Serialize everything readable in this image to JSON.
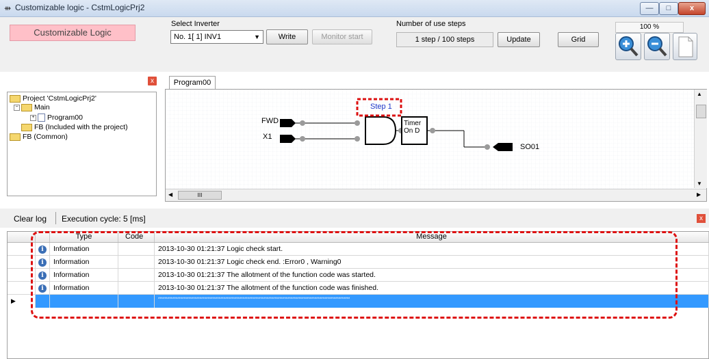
{
  "window": {
    "title": "Customizable logic - CstmLogicPrj2",
    "min": "—",
    "max": "□",
    "close": "x"
  },
  "toolbar": {
    "badge": "Customizable Logic",
    "select_inverter_label": "Select Inverter",
    "inverter_value": "No. 1[ 1] INV1",
    "write_label": "Write",
    "monitor_label": "Monitor start",
    "steps_label": "Number of use steps",
    "steps_value": "1 step / 100 steps",
    "update_label": "Update",
    "grid_label": "Grid",
    "zoom_level": "100 %",
    "icons": [
      "zoom-in-icon",
      "zoom-out-icon",
      "page-icon"
    ]
  },
  "tree": {
    "close": "x",
    "items": [
      "Project 'CstmLogicPrj2'",
      "Main",
      "Program00",
      "FB (Included with the project)",
      "FB (Common)"
    ]
  },
  "editor": {
    "tab": "Program00",
    "step_label": "Step 1",
    "inputs": [
      "FWD",
      "X1"
    ],
    "block": "Timer\nOn D",
    "output": "SO01",
    "hscroll_thumb": "III"
  },
  "log": {
    "clear_label": "Clear log",
    "exec_cycle": "Execution cycle:  5  [ms]",
    "close": "x",
    "headers": [
      "Type",
      "Code",
      "Message"
    ],
    "rows": [
      {
        "type": "Information",
        "code": "",
        "message": "2013-10-30 01:21:37 Logic check start."
      },
      {
        "type": "Information",
        "code": "",
        "message": "2013-10-30 01:21:37 Logic check end.  :Error0 , Warning0"
      },
      {
        "type": "Information",
        "code": "",
        "message": "2013-10-30 01:21:37 The allotment of the function code was started."
      },
      {
        "type": "Information",
        "code": "",
        "message": "2013-10-30 01:21:37 The allotment of the function code was finished."
      },
      {
        "type": "",
        "code": "",
        "message": "************************************************************************************************************************"
      }
    ]
  },
  "colors": {
    "badge": "#ffc0c8",
    "selection": "#3399ff",
    "highlight": "#dd1111"
  }
}
